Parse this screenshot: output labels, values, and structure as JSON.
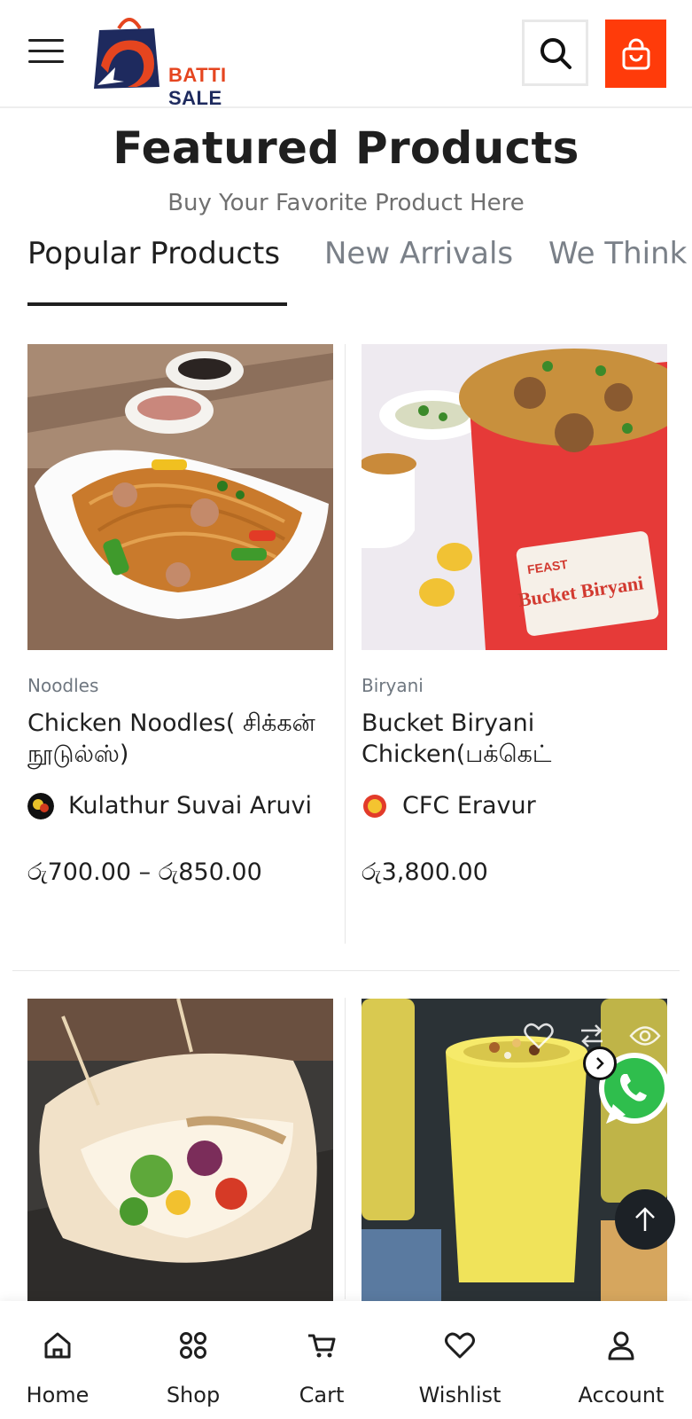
{
  "header": {
    "brand_part1": "BATTI",
    "brand_part2": "SALE",
    "menu_icon": "hamburger-icon",
    "search_icon": "search-icon",
    "cart_icon": "shopping-bag-icon",
    "accent_color": "#ff3b0a",
    "brand_dark": "#1e2a5e"
  },
  "section": {
    "title": "Featured Products",
    "subtitle": "Buy Your Favorite Product Here"
  },
  "tabs": [
    {
      "label": "Popular Products",
      "active": true
    },
    {
      "label": "New Arrivals",
      "active": false
    },
    {
      "label": "We Think",
      "active": false
    }
  ],
  "products": [
    {
      "category": "Noodles",
      "name": "Chicken Noodles( சிக்கன் நூடுல்ஸ்)",
      "vendor": "Kulathur Suvai Aruvi",
      "price": "රු700.00 – රු850.00"
    },
    {
      "category": "Biryani",
      "name": "Bucket Biryani Chicken(பக்கெட்",
      "vendor": "CFC Eravur",
      "price": "රු3,800.00",
      "image_text_1": "FEAST",
      "image_text_2": "Bucket Biryani"
    },
    {
      "category": "",
      "name": "",
      "vendor": "",
      "price": ""
    },
    {
      "category": "",
      "name": "",
      "vendor": "",
      "price": ""
    }
  ],
  "overlay_icons": {
    "wishlist": "heart-icon",
    "compare": "compare-arrows-icon",
    "quick_view": "eye-icon",
    "whatsapp": "whatsapp-icon",
    "scroll_top": "arrow-up-icon"
  },
  "bottom_nav": [
    {
      "label": "Home",
      "icon": "home-icon"
    },
    {
      "label": "Shop",
      "icon": "grid-dots-icon"
    },
    {
      "label": "Cart",
      "icon": "cart-icon"
    },
    {
      "label": "Wishlist",
      "icon": "heart-icon"
    },
    {
      "label": "Account",
      "icon": "user-icon"
    }
  ]
}
